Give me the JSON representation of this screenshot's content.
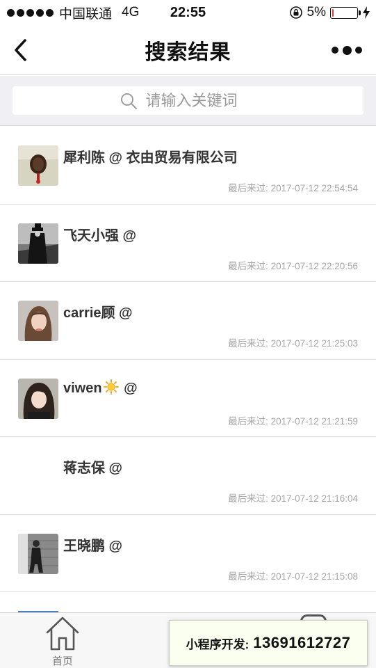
{
  "status_bar": {
    "carrier": "中国联通",
    "network": "4G",
    "time": "22:55",
    "battery_percent": "5%",
    "battery_level": 0.05,
    "battery_color": "#e53935"
  },
  "nav": {
    "title": "搜索结果",
    "back_icon": "chevron-left-icon",
    "more_icon": "more-dots-icon"
  },
  "search": {
    "placeholder": "请输入关键词",
    "value": ""
  },
  "results": [
    {
      "name": "犀利陈 @ 衣由贸易有限公司",
      "time_label": "最后来过:",
      "time": "2017-07-12 22:54:54",
      "has_avatar": true
    },
    {
      "name": "飞天小强 @",
      "time_label": "最后来过:",
      "time": "2017-07-12 22:20:56",
      "has_avatar": true
    },
    {
      "name": "carrie顾 @",
      "time_label": "最后来过:",
      "time": "2017-07-12 21:25:03",
      "has_avatar": true
    },
    {
      "name_prefix": "viwen",
      "name_suffix": "@",
      "name_emoji": "sun-icon",
      "time_label": "最后来过:",
      "time": "2017-07-12 21:21:59",
      "has_avatar": true
    },
    {
      "name": "蒋志保 @",
      "time_label": "最后来过:",
      "time": "2017-07-12 21:16:04",
      "has_avatar": false
    },
    {
      "name": "王晓鹏 @",
      "time_label": "最后来过:",
      "time": "2017-07-12 21:15:08",
      "has_avatar": true
    }
  ],
  "tab_bar": {
    "home_label": "首页",
    "home_icon": "home-icon"
  },
  "ad": {
    "label": "小程序开发:",
    "phone": "13691612727"
  }
}
